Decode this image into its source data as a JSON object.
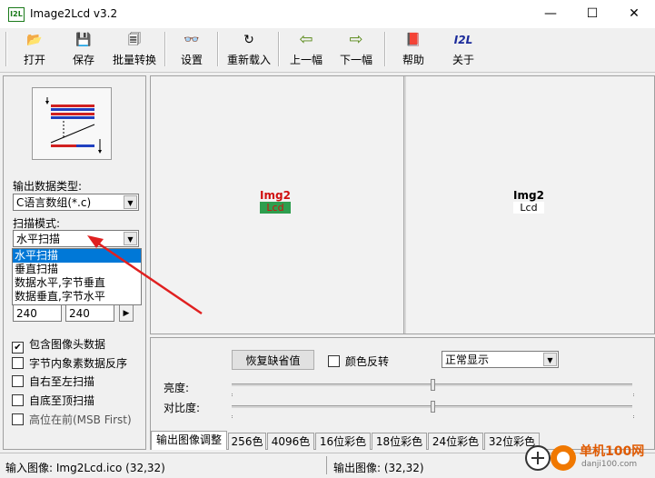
{
  "app": {
    "title": "Image2Lcd v3.2",
    "icon_text": "I2L"
  },
  "window_controls": {
    "minimize": "—",
    "maximize": "☐",
    "close": "✕"
  },
  "toolbar": [
    {
      "label": "打开",
      "icon": "open-folder-icon",
      "glyph": "📂"
    },
    {
      "label": "保存",
      "icon": "save-disk-icon",
      "glyph": "💾"
    },
    {
      "label": "批量转换",
      "icon": "batch-convert-icon",
      "glyph": "🗐"
    },
    {
      "label": "设置",
      "icon": "settings-glasses-icon",
      "glyph": "👓"
    },
    {
      "label": "重新载入",
      "icon": "reload-icon",
      "glyph": "↻"
    },
    {
      "label": "上一幅",
      "icon": "prev-arrow-icon",
      "glyph": "⇦"
    },
    {
      "label": "下一幅",
      "icon": "next-arrow-icon",
      "glyph": "⇨"
    },
    {
      "label": "帮助",
      "icon": "help-book-icon",
      "glyph": "📕"
    },
    {
      "label": "关于",
      "icon": "about-i2l-icon",
      "glyph": "I2L"
    }
  ],
  "left": {
    "output_type_label": "输出数据类型:",
    "output_type_value": "C语言数组(*.c)",
    "scan_mode_label": "扫描模式:",
    "scan_mode_value": "水平扫描",
    "scan_mode_options": [
      "水平扫描",
      "垂直扫描",
      "数据水平,字节垂直",
      "数据垂直,字节水平"
    ],
    "width_value": "240",
    "height_value": "240",
    "spin_glyph": "▶",
    "checkboxes": [
      {
        "label": "包含图像头数据",
        "checked": true
      },
      {
        "label": "字节内象素数据反序",
        "checked": false
      },
      {
        "label": "自右至左扫描",
        "checked": false
      },
      {
        "label": "自底至顶扫描",
        "checked": false
      },
      {
        "label": "高位在前(MSB First)",
        "checked": false
      }
    ]
  },
  "preview": {
    "logo_top": "Img2",
    "logo_bottom": "Lcd"
  },
  "controls": {
    "restore_default": "恢复缺省值",
    "invert_color": "颜色反转",
    "display_mode": "正常显示",
    "brightness_label": "亮度:",
    "contrast_label": "对比度:",
    "brightness": 0.5,
    "contrast": 0.5
  },
  "tabs": [
    "输出图像调整",
    "256色",
    "4096色",
    "16位彩色",
    "18位彩色",
    "24位彩色",
    "32位彩色"
  ],
  "status": {
    "input_image": "输入图像:  Img2Lcd.ico (32,32)",
    "output_image": "输出图像:  (32,32)"
  },
  "watermark": {
    "text": "单机100网",
    "url": "danji100.com"
  },
  "colors": {
    "selection": "#0078d7",
    "arrow": "#e02020",
    "logo_red": "#d01010",
    "logo_green": "#2e9e4e"
  }
}
